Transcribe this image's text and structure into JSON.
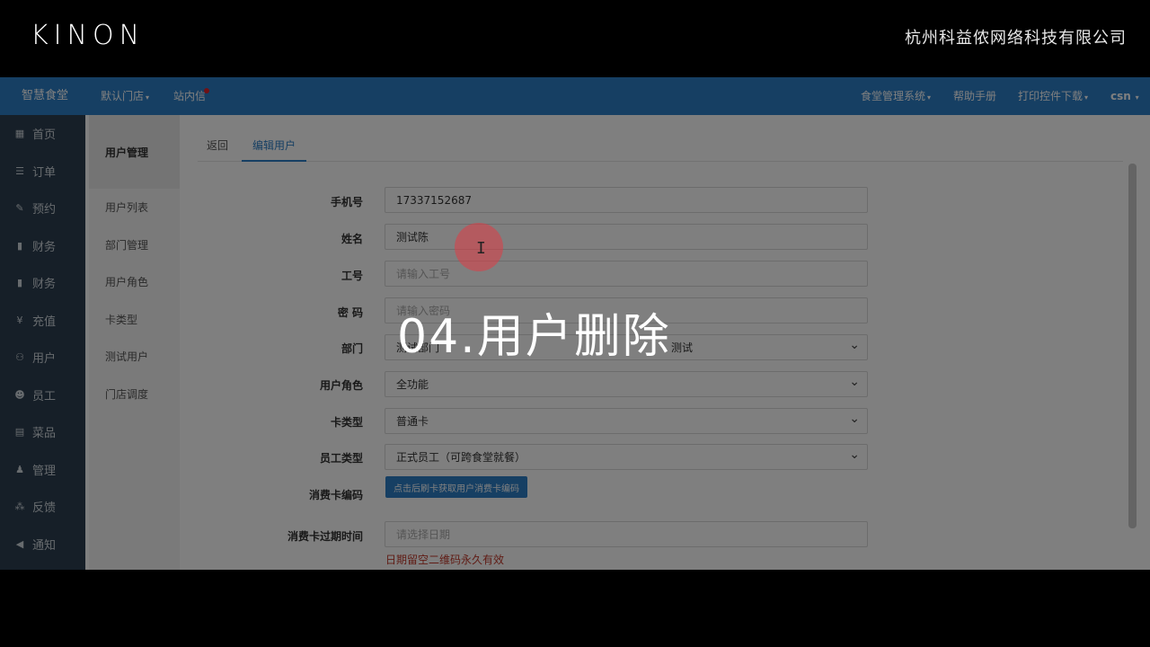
{
  "brand": {
    "logo": "KINON",
    "company": "杭州科益侬网络科技有限公司"
  },
  "navbar": {
    "home": "智慧食堂",
    "store": "默认门店",
    "inbox": "站内信",
    "system": "食堂管理系统",
    "help": "帮助手册",
    "print": "打印控件下载",
    "user": "csn"
  },
  "sidebar": {
    "items": [
      {
        "icon": "home-icon",
        "glyph": "▦",
        "label": "首页"
      },
      {
        "icon": "order-icon",
        "glyph": "☰",
        "label": "订单"
      },
      {
        "icon": "reserve-icon",
        "glyph": "✎",
        "label": "预约"
      },
      {
        "icon": "finance-icon",
        "glyph": "▮",
        "label": "财务"
      },
      {
        "icon": "finance2-icon",
        "glyph": "▮",
        "label": "财务"
      },
      {
        "icon": "recharge-icon",
        "glyph": "¥",
        "label": "充值"
      },
      {
        "icon": "users-icon",
        "glyph": "⚇",
        "label": "用户"
      },
      {
        "icon": "staff-icon",
        "glyph": "☻",
        "label": "员工"
      },
      {
        "icon": "dish-icon",
        "glyph": "▤",
        "label": "菜品"
      },
      {
        "icon": "admin-icon",
        "glyph": "♟",
        "label": "管理"
      },
      {
        "icon": "feedback-icon",
        "glyph": "⁂",
        "label": "反馈"
      },
      {
        "icon": "notice-icon",
        "glyph": "◀",
        "label": "通知"
      }
    ]
  },
  "subnav": {
    "title": "用户管理",
    "items": [
      "用户列表",
      "部门管理",
      "用户角色",
      "卡类型",
      "测试用户",
      "门店调度"
    ]
  },
  "tabs": {
    "back": "返回",
    "edit": "编辑用户"
  },
  "form": {
    "phone_label": "手机号",
    "phone_value": "17337152687",
    "name_label": "姓名",
    "name_value": "测试陈",
    "jobno_label": "工号",
    "jobno_placeholder": "请输入工号",
    "password_label": "密 码",
    "password_placeholder": "请输入密码",
    "dept_label": "部门",
    "dept_value": "测试部门",
    "dept_extra": "测试",
    "role_label": "用户角色",
    "role_value": "全功能",
    "cardtype_label": "卡类型",
    "cardtype_value": "普通卡",
    "stafftype_label": "员工类型",
    "stafftype_value": "正式员工（可跨食堂就餐）",
    "cardcode_label": "消费卡编码",
    "cardcode_button": "点击后刷卡获取用户消费卡编码",
    "expire_label": "消费卡过期时间",
    "expire_placeholder": "请选择日期",
    "expire_hint": "日期留空二维码永久有效"
  },
  "overlay": {
    "title": "04.用户删除"
  }
}
